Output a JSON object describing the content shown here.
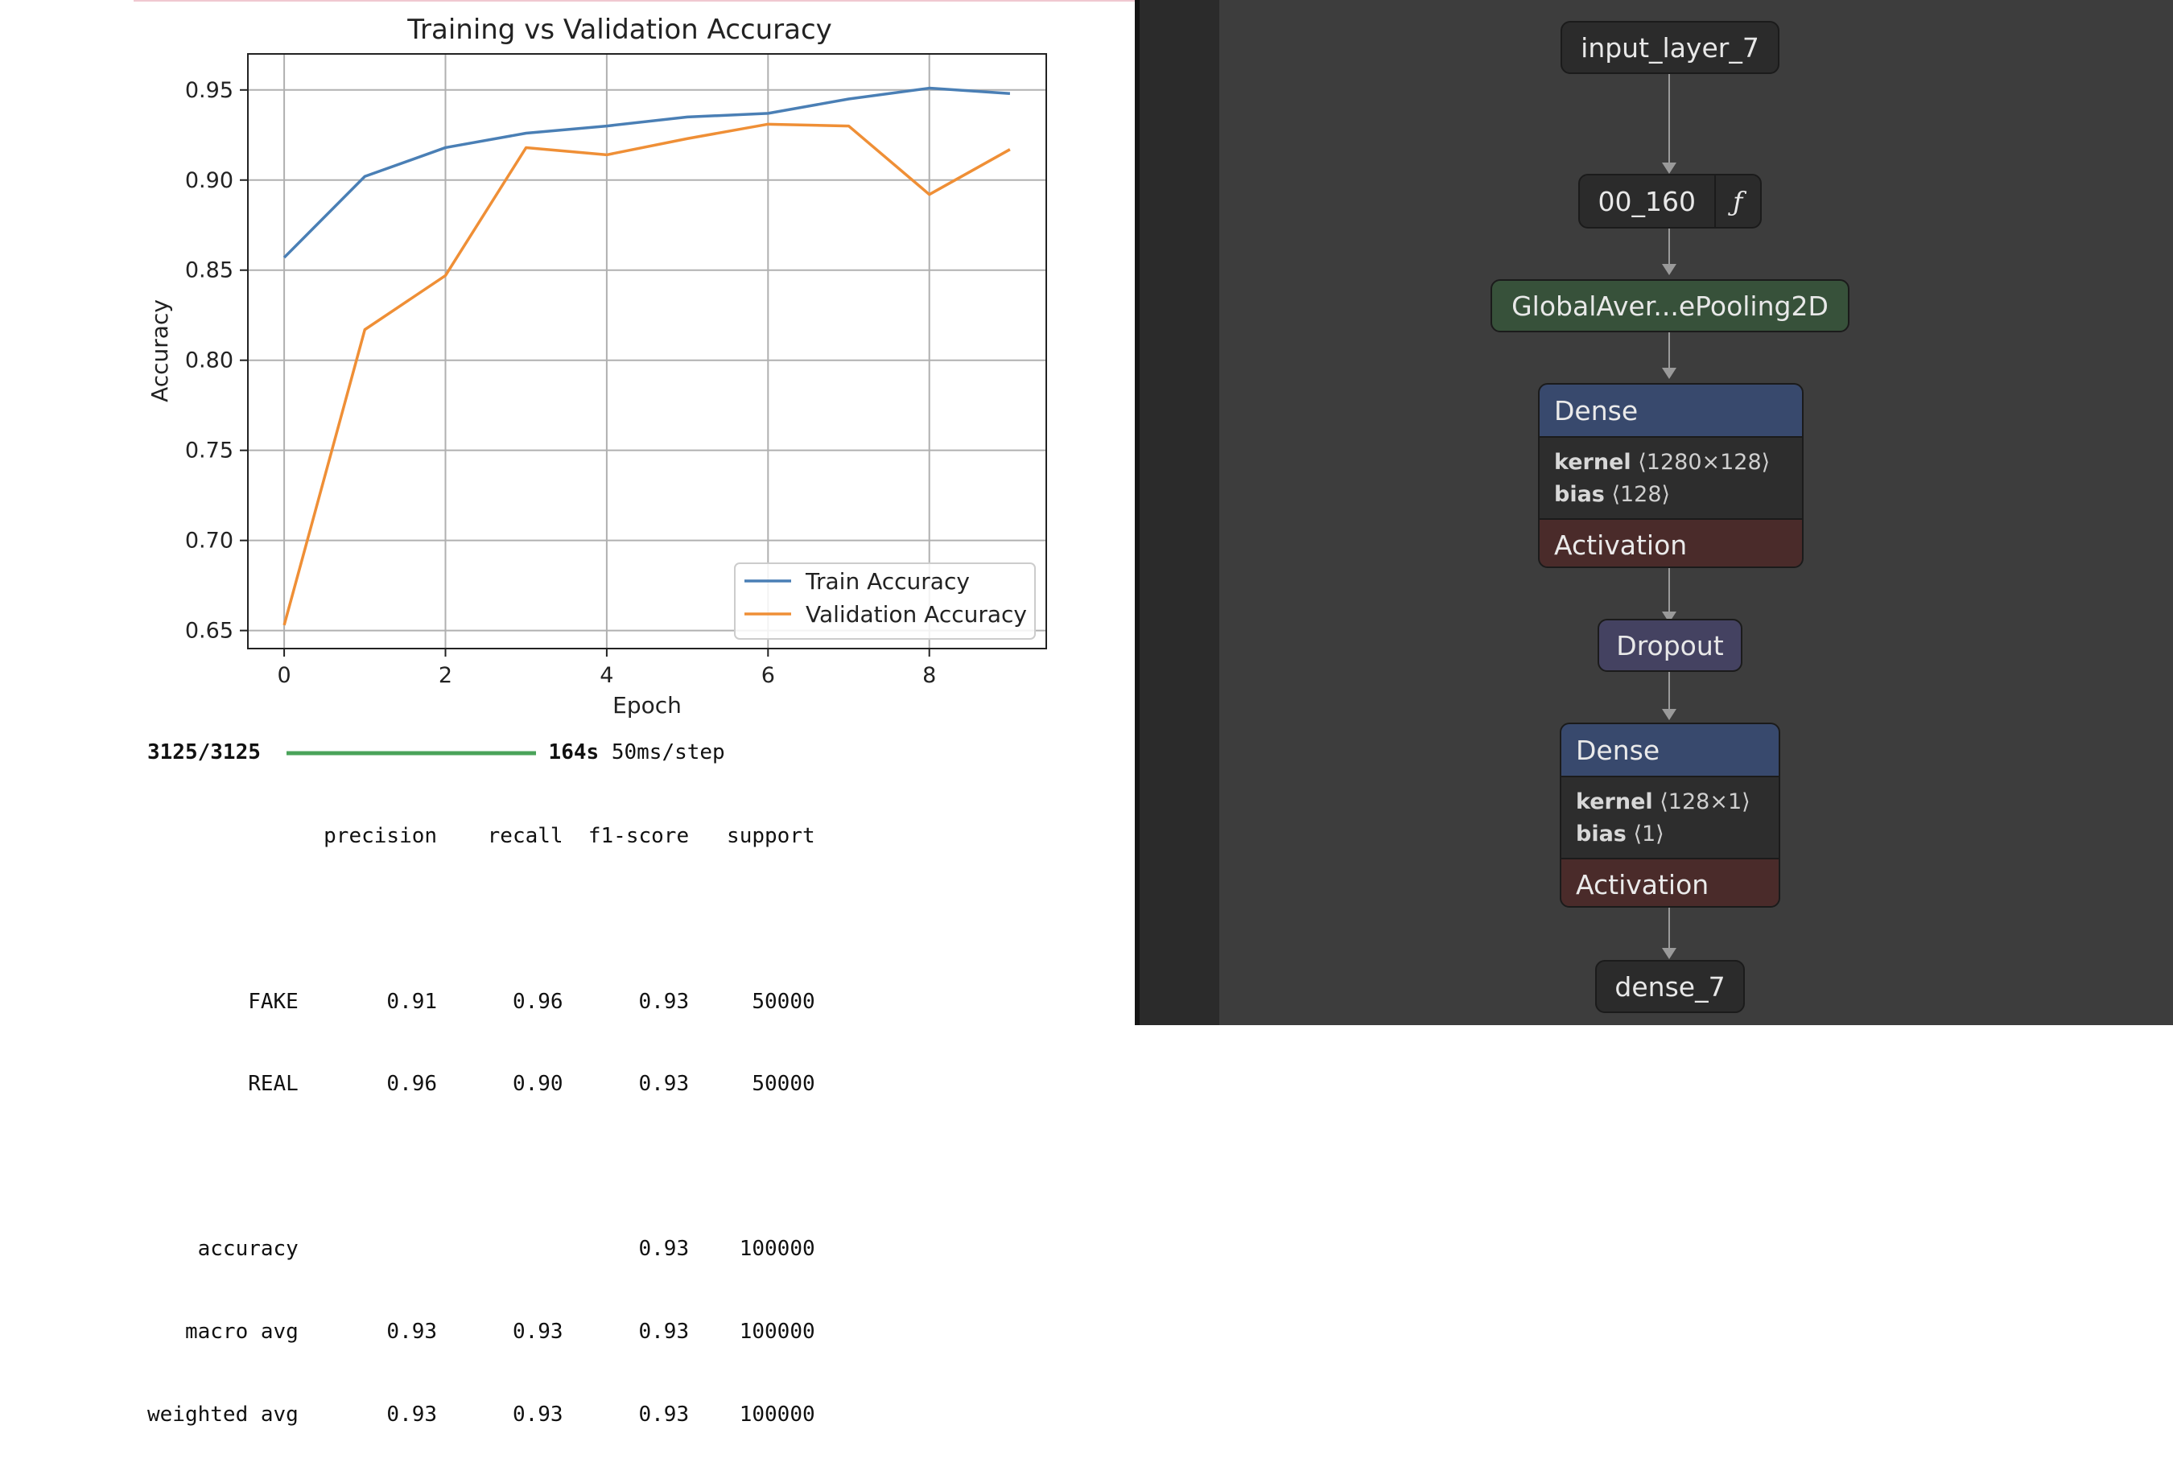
{
  "colors": {
    "train": "#4a7fb5",
    "validation": "#ef8f36",
    "progress": "#4aa35a",
    "top_accent": "#f0c8d0",
    "dense_header": "#38496d",
    "activation": "#4a2b2a",
    "pooling": "#37513a",
    "dropout": "#444261"
  },
  "chart_data": {
    "type": "line",
    "title": "Training vs Validation Accuracy",
    "xlabel": "Epoch",
    "ylabel": "Accuracy",
    "x": [
      0,
      1,
      2,
      3,
      4,
      5,
      6,
      7,
      8,
      9
    ],
    "xlim": [
      -0.45,
      9.45
    ],
    "ylim": [
      0.64,
      0.97
    ],
    "x_ticks": [
      "0",
      "2",
      "4",
      "6",
      "8"
    ],
    "y_ticks": [
      "0.65",
      "0.70",
      "0.75",
      "0.80",
      "0.85",
      "0.90",
      "0.95"
    ],
    "grid": true,
    "legend_position": "lower-right",
    "series": [
      {
        "name": "Train Accuracy",
        "values": [
          0.857,
          0.902,
          0.918,
          0.926,
          0.93,
          0.935,
          0.937,
          0.945,
          0.951,
          0.948
        ]
      },
      {
        "name": "Validation Accuracy",
        "values": [
          0.653,
          0.817,
          0.847,
          0.918,
          0.914,
          0.923,
          0.931,
          0.93,
          0.892,
          0.917
        ]
      }
    ]
  },
  "output": {
    "progress_count": "3125/3125",
    "progress_fraction": 1.0,
    "elapsed": "164s",
    "step_time": " 50ms/step",
    "report_lines": [
      "              precision    recall  f1-score   support",
      "",
      "        FAKE       0.91      0.96      0.93     50000",
      "        REAL       0.96      0.90      0.93     50000",
      "",
      "    accuracy                           0.93    100000",
      "   macro avg       0.93      0.93      0.93    100000",
      "weighted avg       0.93      0.93      0.93    100000"
    ]
  },
  "model_graph": {
    "input_node": "input_layer_7",
    "fn_node": {
      "name": "00_160",
      "icon": "ƒ"
    },
    "pooling_node": "GlobalAver...ePooling2D",
    "dense_1": {
      "title": "Dense",
      "kernel_label": "kernel",
      "kernel_shape": "⟨1280×128⟩",
      "bias_label": "bias",
      "bias_shape": "⟨128⟩",
      "activation": "Activation"
    },
    "dropout_node": "Dropout",
    "dense_2": {
      "title": "Dense",
      "kernel_label": "kernel",
      "kernel_shape": "⟨128×1⟩",
      "bias_label": "bias",
      "bias_shape": "⟨1⟩",
      "activation": "Activation"
    },
    "output_node": "dense_7"
  }
}
